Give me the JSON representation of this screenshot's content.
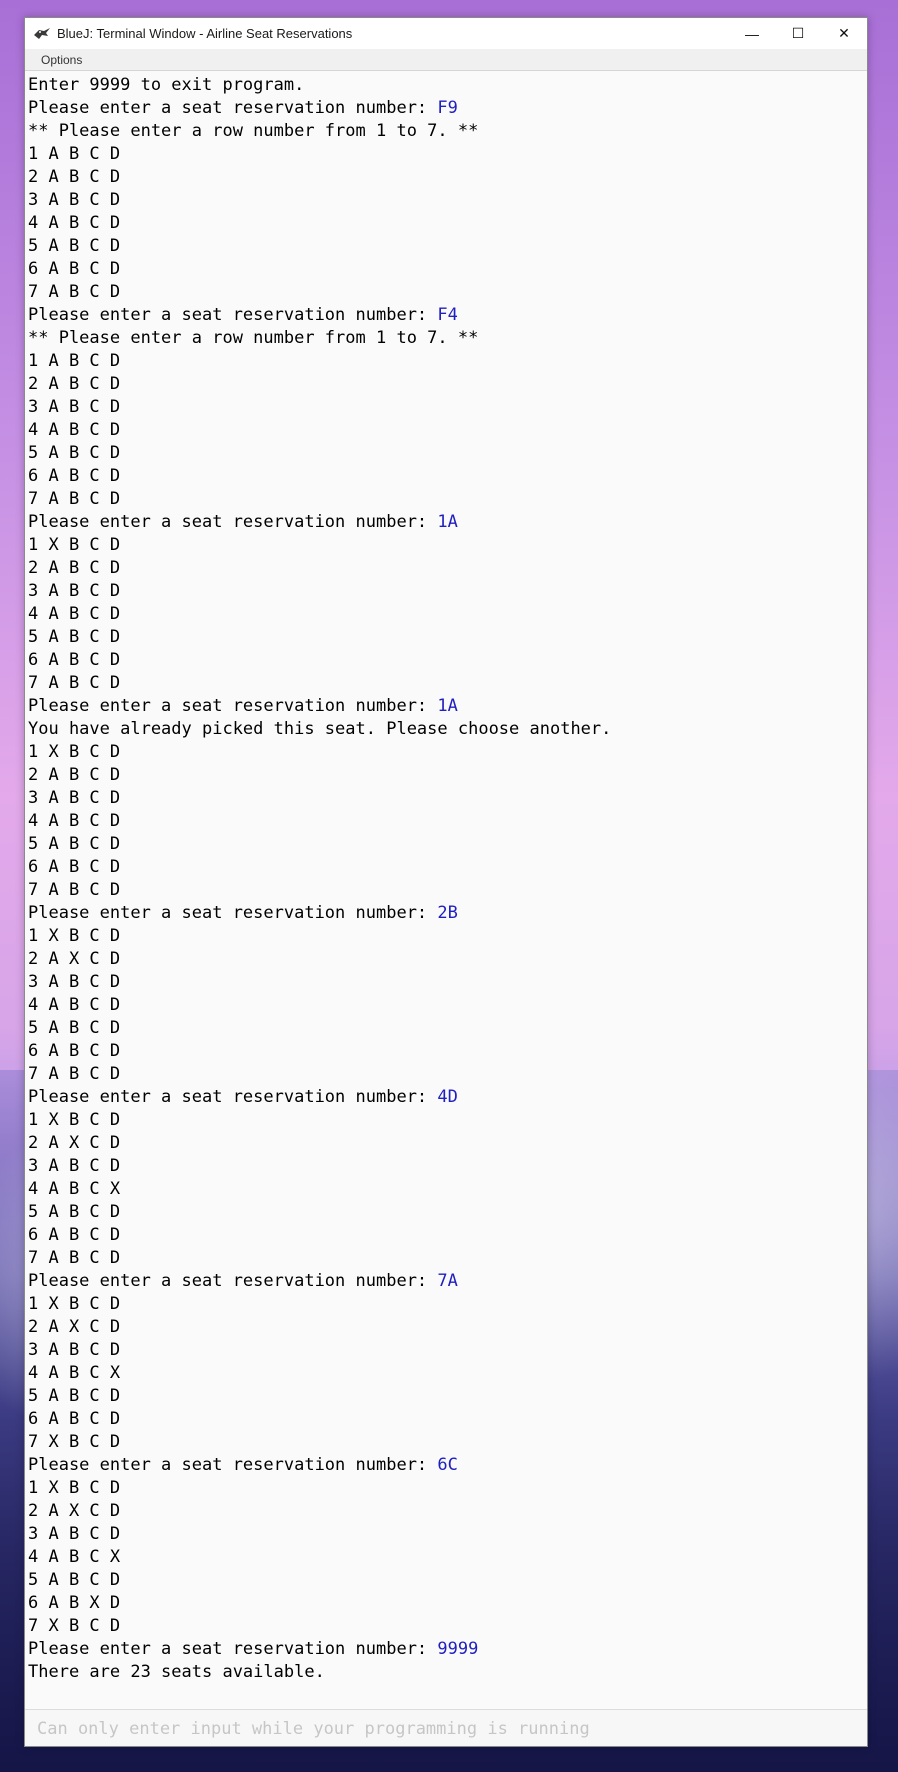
{
  "window": {
    "title": "BlueJ: Terminal Window - Airline Seat Reservations",
    "menu": [
      "Options"
    ],
    "controls": {
      "minimize": "—",
      "maximize": "☐",
      "close": "✕"
    }
  },
  "terminal": {
    "lines": [
      {
        "text": "Enter 9999 to exit program.",
        "input": ""
      },
      {
        "text": "Please enter a seat reservation number: ",
        "input": "F9"
      },
      {
        "text": "** Please enter a row number from 1 to 7. **",
        "input": ""
      },
      {
        "text": "1 A B C D",
        "input": ""
      },
      {
        "text": "2 A B C D",
        "input": ""
      },
      {
        "text": "3 A B C D",
        "input": ""
      },
      {
        "text": "4 A B C D",
        "input": ""
      },
      {
        "text": "5 A B C D",
        "input": ""
      },
      {
        "text": "6 A B C D",
        "input": ""
      },
      {
        "text": "7 A B C D",
        "input": ""
      },
      {
        "text": "Please enter a seat reservation number: ",
        "input": "F4"
      },
      {
        "text": "** Please enter a row number from 1 to 7. **",
        "input": ""
      },
      {
        "text": "1 A B C D",
        "input": ""
      },
      {
        "text": "2 A B C D",
        "input": ""
      },
      {
        "text": "3 A B C D",
        "input": ""
      },
      {
        "text": "4 A B C D",
        "input": ""
      },
      {
        "text": "5 A B C D",
        "input": ""
      },
      {
        "text": "6 A B C D",
        "input": ""
      },
      {
        "text": "7 A B C D",
        "input": ""
      },
      {
        "text": "Please enter a seat reservation number: ",
        "input": "1A"
      },
      {
        "text": "1 X B C D",
        "input": ""
      },
      {
        "text": "2 A B C D",
        "input": ""
      },
      {
        "text": "3 A B C D",
        "input": ""
      },
      {
        "text": "4 A B C D",
        "input": ""
      },
      {
        "text": "5 A B C D",
        "input": ""
      },
      {
        "text": "6 A B C D",
        "input": ""
      },
      {
        "text": "7 A B C D",
        "input": ""
      },
      {
        "text": "Please enter a seat reservation number: ",
        "input": "1A"
      },
      {
        "text": "You have already picked this seat. Please choose another.",
        "input": ""
      },
      {
        "text": "1 X B C D",
        "input": ""
      },
      {
        "text": "2 A B C D",
        "input": ""
      },
      {
        "text": "3 A B C D",
        "input": ""
      },
      {
        "text": "4 A B C D",
        "input": ""
      },
      {
        "text": "5 A B C D",
        "input": ""
      },
      {
        "text": "6 A B C D",
        "input": ""
      },
      {
        "text": "7 A B C D",
        "input": ""
      },
      {
        "text": "Please enter a seat reservation number: ",
        "input": "2B"
      },
      {
        "text": "1 X B C D",
        "input": ""
      },
      {
        "text": "2 A X C D",
        "input": ""
      },
      {
        "text": "3 A B C D",
        "input": ""
      },
      {
        "text": "4 A B C D",
        "input": ""
      },
      {
        "text": "5 A B C D",
        "input": ""
      },
      {
        "text": "6 A B C D",
        "input": ""
      },
      {
        "text": "7 A B C D",
        "input": ""
      },
      {
        "text": "Please enter a seat reservation number: ",
        "input": "4D"
      },
      {
        "text": "1 X B C D",
        "input": ""
      },
      {
        "text": "2 A X C D",
        "input": ""
      },
      {
        "text": "3 A B C D",
        "input": ""
      },
      {
        "text": "4 A B C X",
        "input": ""
      },
      {
        "text": "5 A B C D",
        "input": ""
      },
      {
        "text": "6 A B C D",
        "input": ""
      },
      {
        "text": "7 A B C D",
        "input": ""
      },
      {
        "text": "Please enter a seat reservation number: ",
        "input": "7A"
      },
      {
        "text": "1 X B C D",
        "input": ""
      },
      {
        "text": "2 A X C D",
        "input": ""
      },
      {
        "text": "3 A B C D",
        "input": ""
      },
      {
        "text": "4 A B C X",
        "input": ""
      },
      {
        "text": "5 A B C D",
        "input": ""
      },
      {
        "text": "6 A B C D",
        "input": ""
      },
      {
        "text": "7 X B C D",
        "input": ""
      },
      {
        "text": "Please enter a seat reservation number: ",
        "input": "6C"
      },
      {
        "text": "1 X B C D",
        "input": ""
      },
      {
        "text": "2 A X C D",
        "input": ""
      },
      {
        "text": "3 A B C D",
        "input": ""
      },
      {
        "text": "4 A B C X",
        "input": ""
      },
      {
        "text": "5 A B C D",
        "input": ""
      },
      {
        "text": "6 A B X D",
        "input": ""
      },
      {
        "text": "7 X B C D",
        "input": ""
      },
      {
        "text": "Please enter a seat reservation number: ",
        "input": "9999"
      },
      {
        "text": "There are 23 seats available.",
        "input": ""
      }
    ]
  },
  "input_bar": {
    "placeholder": "Can only enter input while your programming is running"
  },
  "colors": {
    "input_text": "#2020c0",
    "terminal_bg": "#fafafa"
  }
}
